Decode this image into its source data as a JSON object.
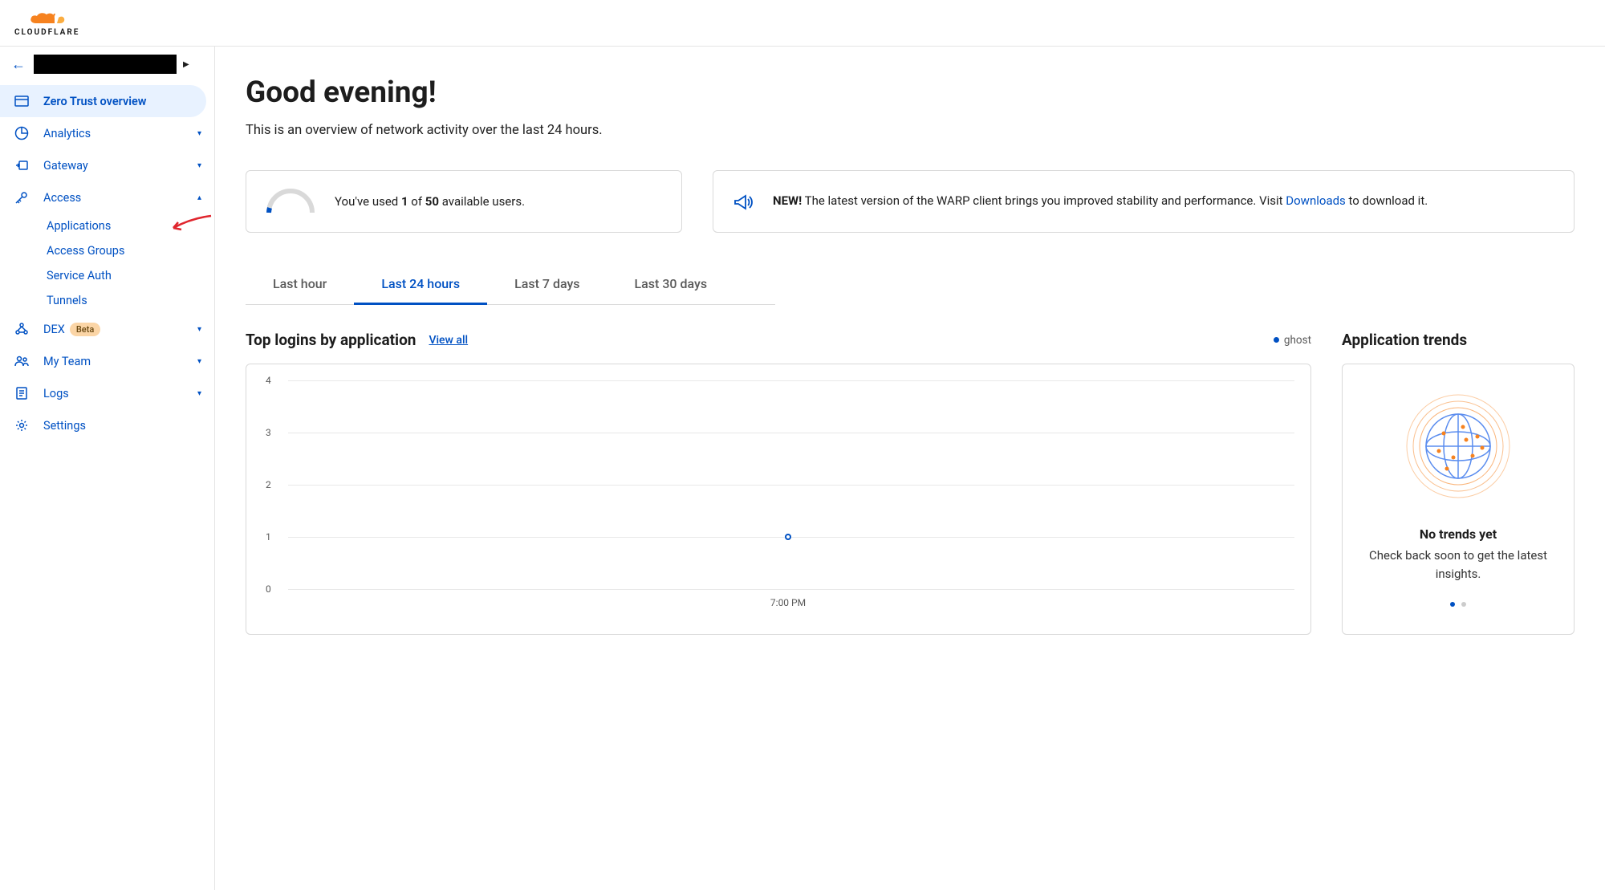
{
  "brand": "CLOUDFLARE",
  "sidebar": {
    "items": [
      {
        "label": "Zero Trust overview"
      },
      {
        "label": "Analytics"
      },
      {
        "label": "Gateway"
      },
      {
        "label": "Access"
      },
      {
        "label": "DEX"
      },
      {
        "label": "My Team"
      },
      {
        "label": "Logs"
      },
      {
        "label": "Settings"
      }
    ],
    "access_subitems": [
      {
        "label": "Applications"
      },
      {
        "label": "Access Groups"
      },
      {
        "label": "Service Auth"
      },
      {
        "label": "Tunnels"
      }
    ],
    "beta": "Beta"
  },
  "main": {
    "title": "Good evening!",
    "subtitle": "This is an overview of network activity over the last 24 hours.",
    "usage": {
      "prefix": "You've used ",
      "used": "1",
      "mid": " of ",
      "total": "50",
      "suffix": " available users."
    },
    "news": {
      "new": "NEW!",
      "text": " The latest version of the WARP client brings you improved stability and performance. Visit ",
      "link": "Downloads",
      "tail": " to download it."
    },
    "tabs": [
      "Last hour",
      "Last 24 hours",
      "Last 7 days",
      "Last 30 days"
    ],
    "chart_title": "Top logins by application",
    "view_all": "View all",
    "legend": "ghost",
    "trends": {
      "title": "Application trends",
      "heading": "No trends yet",
      "sub": "Check back soon to get the latest insights."
    }
  },
  "chart_data": {
    "type": "scatter",
    "title": "Top logins by application",
    "x": [
      "7:00 PM"
    ],
    "series": [
      {
        "name": "ghost",
        "values": [
          1
        ]
      }
    ],
    "y_ticks": [
      0,
      1,
      2,
      3,
      4
    ],
    "ylim": [
      0,
      4
    ],
    "xlabel": "",
    "ylabel": ""
  }
}
